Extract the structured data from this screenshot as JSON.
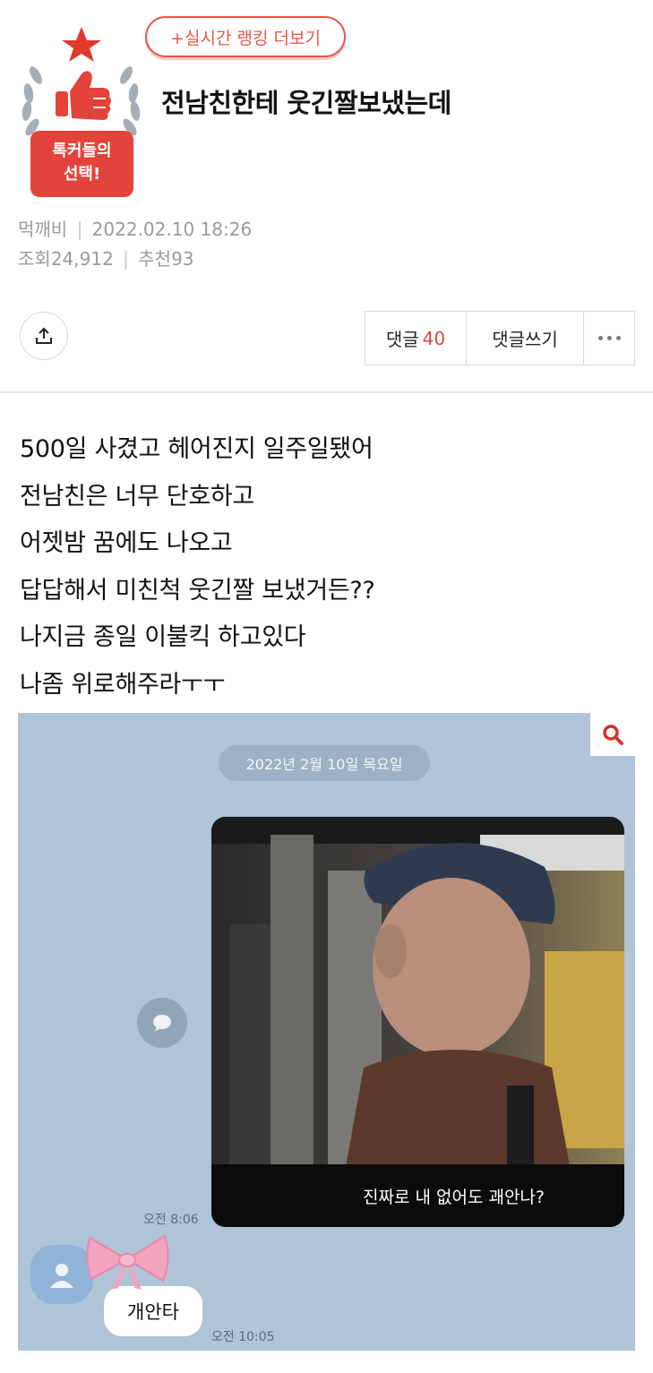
{
  "header": {
    "ranking_button": "+실시간 랭킹 더보기",
    "badge": {
      "line1": "톡커들의",
      "line2": "선택!"
    },
    "title": "전남친한테 웃긴짤보냈는데",
    "author": "먹깨비",
    "datetime": "2022.02.10 18:26",
    "views_label": "조회",
    "views": "24,912",
    "likes_label": "추천",
    "likes": "93"
  },
  "actions": {
    "comments_label": "댓글",
    "comments_count": "40",
    "write_label": "댓글쓰기",
    "share_icon": "share-icon",
    "more_icon": "more-icon"
  },
  "body": {
    "lines": [
      "500일 사겼고 헤어진지 일주일됐어",
      "전남친은 너무 단호하고",
      "어젯밤 꿈에도 나오고",
      "답답해서 미친척 웃긴짤 보냈거든??",
      "나지금 종일 이불킥 하고있다",
      "나좀 위로해주라ㅜㅜ"
    ]
  },
  "chat": {
    "date": "2022년 2월 10일 목요일",
    "meme_caption": "진짜로 내 없어도 괘안나?",
    "sent_time": "오전 8:06",
    "reply_text": "개안타",
    "reply_time": "오전 10:05",
    "bg_color": "#afc4d6"
  },
  "colors": {
    "accent": "#e9554a",
    "count_red": "#d9463c"
  }
}
